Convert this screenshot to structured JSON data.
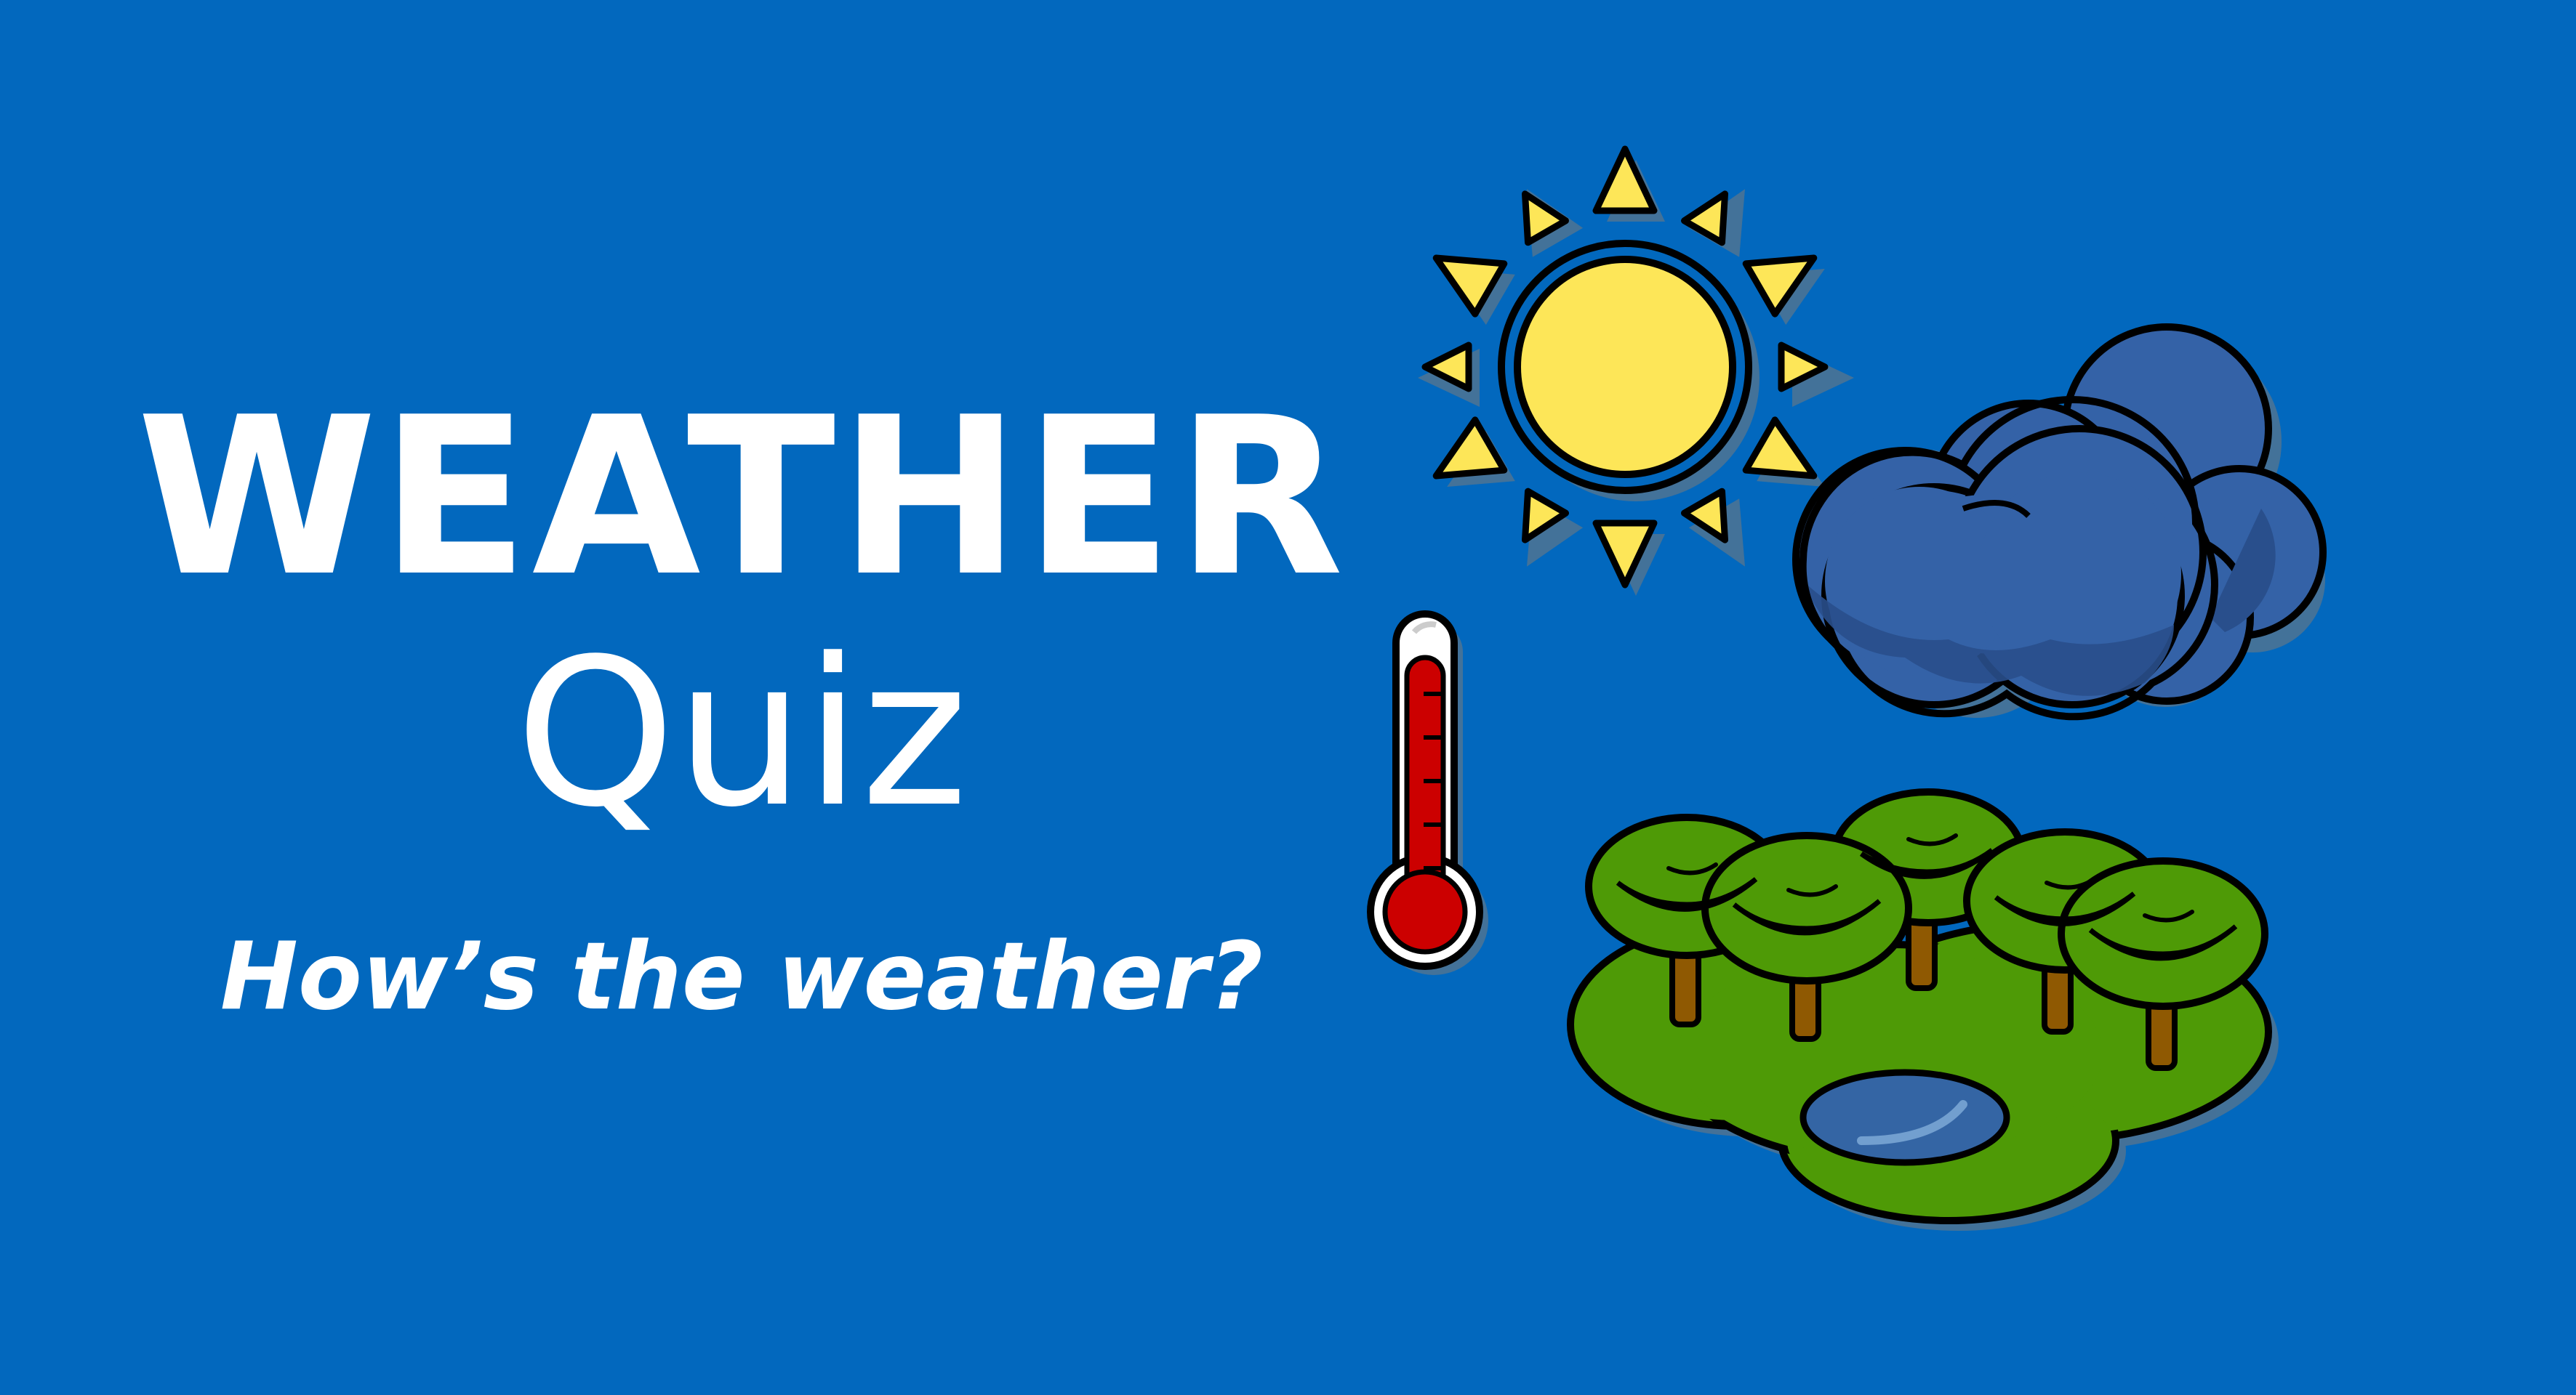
{
  "title": {
    "main": "WEATHER",
    "sub": "Quiz",
    "tagline": "How’s the weather?"
  },
  "colors": {
    "background": "#0268BE",
    "sun": "#FDE658",
    "cloud": "#3462A7",
    "cloud_dark": "#294F8C",
    "thermometer_red": "#CC0000",
    "grass": "#4E9A06",
    "tree_top": "#4E9A06",
    "tree_highlight": "#73D216",
    "trunk": "#8F5902",
    "pond": "#3465A4",
    "pond_highlight": "#729FCF"
  },
  "icons": [
    "sun-icon",
    "cloud-icon",
    "thermometer-icon",
    "landscape-trees-icon"
  ]
}
